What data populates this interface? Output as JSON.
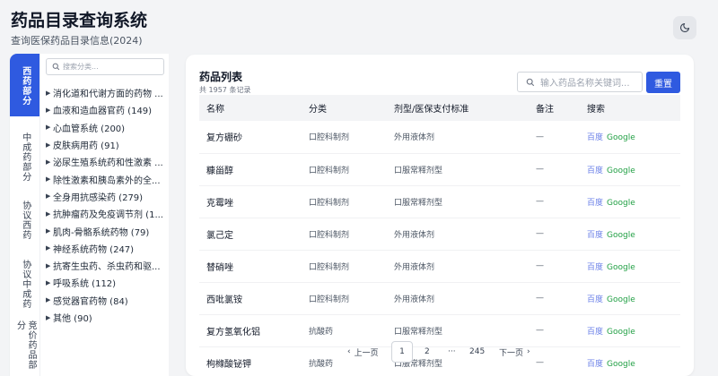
{
  "header": {
    "title": "药品目录查询系统",
    "subtitle": "查询医保药品目录信息(2024)",
    "theme_icon": "moon-icon"
  },
  "tabs": [
    {
      "label": "西药部分",
      "active": true
    },
    {
      "label": "中成药部分",
      "active": false
    },
    {
      "label": "协议西药",
      "active": false
    },
    {
      "label": "协议中成药",
      "active": false
    },
    {
      "label": "竞价药品部分",
      "active": false
    }
  ],
  "category_panel": {
    "search_placeholder": "搜索分类...",
    "items": [
      "消化道和代谢方面的药物 ...",
      "血液和造血器官药 (149)",
      "心血管系统 (200)",
      "皮肤病用药 (91)",
      "泌尿生殖系统药和性激素 ...",
      "除性激素和胰岛素外的全...",
      "全身用抗感染药 (279)",
      "抗肿瘤药及免疫调节剂 (1...",
      "肌肉-骨骼系统药物 (79)",
      "神经系统药物 (247)",
      "抗寄生虫药、杀虫药和驱...",
      "呼吸系统 (112)",
      "感觉器官药物 (84)",
      "其他 (90)"
    ]
  },
  "drug_list": {
    "title": "药品列表",
    "count": "共 1957 条记录",
    "search_placeholder": "输入药品名称关键词...",
    "reset_label": "重置",
    "columns": [
      "名称",
      "分类",
      "剂型/医保支付标准",
      "备注",
      "搜索"
    ],
    "rows": [
      {
        "name": "复方硼砂",
        "category": "口腔科制剂",
        "form": "外用液体剂",
        "note": "—"
      },
      {
        "name": "糠甾醇",
        "category": "口腔科制剂",
        "form": "口服常释剂型",
        "note": "—"
      },
      {
        "name": "克霉唑",
        "category": "口腔科制剂",
        "form": "口服常释剂型",
        "note": "—"
      },
      {
        "name": "氯己定",
        "category": "口腔科制剂",
        "form": "外用液体剂",
        "note": "—"
      },
      {
        "name": "替硝唑",
        "category": "口腔科制剂",
        "form": "外用液体剂",
        "note": "—"
      },
      {
        "name": "西吡氯铵",
        "category": "口腔科制剂",
        "form": "外用液体剂",
        "note": "—"
      },
      {
        "name": "复方氢氧化铝",
        "category": "抗酸药",
        "form": "口服常释剂型",
        "note": "—"
      },
      {
        "name": "枸橼酸铋钾",
        "category": "抗酸药",
        "form": "口服常释剂型",
        "note": "—"
      }
    ],
    "link_baidu": "百度",
    "link_google": "Google"
  },
  "pagination": {
    "prev": "上一页",
    "pages": [
      "1",
      "2",
      "···",
      "245"
    ],
    "next": "下一页",
    "current": "1"
  },
  "colors": {
    "accent": "#2f5ae0",
    "baidu_link": "#6b80e8",
    "google_link": "#22a045"
  }
}
